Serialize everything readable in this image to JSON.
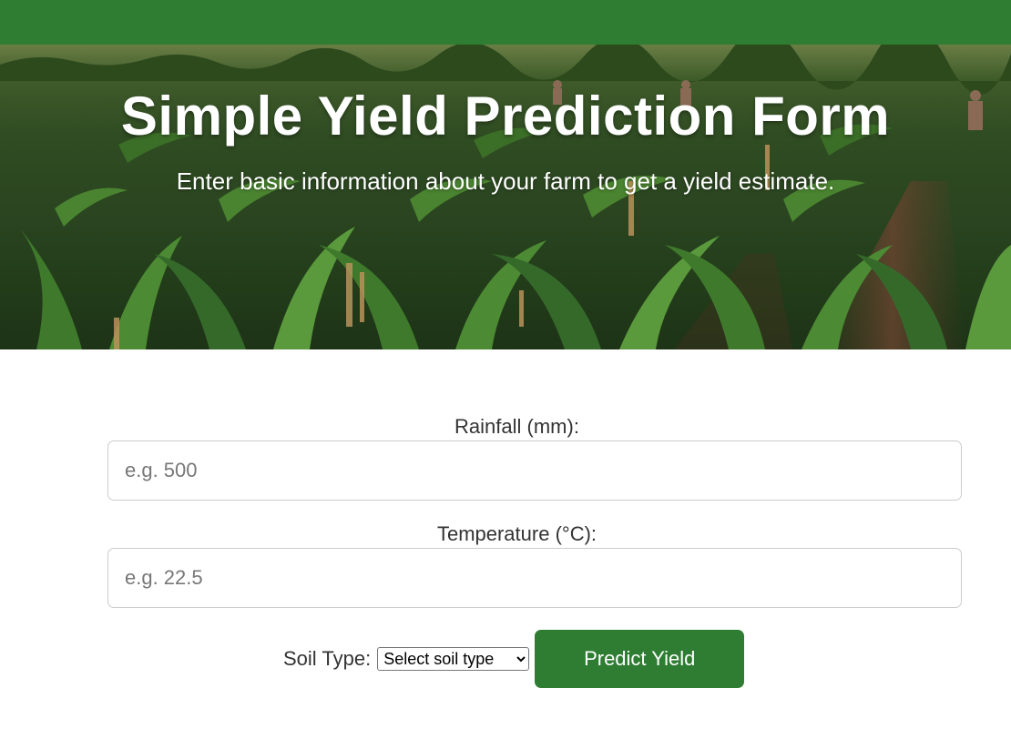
{
  "hero": {
    "title": "Simple Yield Prediction Form",
    "subtitle": "Enter basic information about your farm to get a yield estimate."
  },
  "form": {
    "rainfall": {
      "label": "Rainfall (mm):",
      "placeholder": "e.g. 500",
      "value": ""
    },
    "temperature": {
      "label": "Temperature (°C):",
      "placeholder": "e.g. 22.5",
      "value": ""
    },
    "soil": {
      "label": "Soil Type:",
      "selected": "Select soil type"
    },
    "submit_label": "Predict Yield"
  },
  "colors": {
    "brand_green": "#2e7d32",
    "text": "#333333",
    "input_border": "#cccccc"
  }
}
